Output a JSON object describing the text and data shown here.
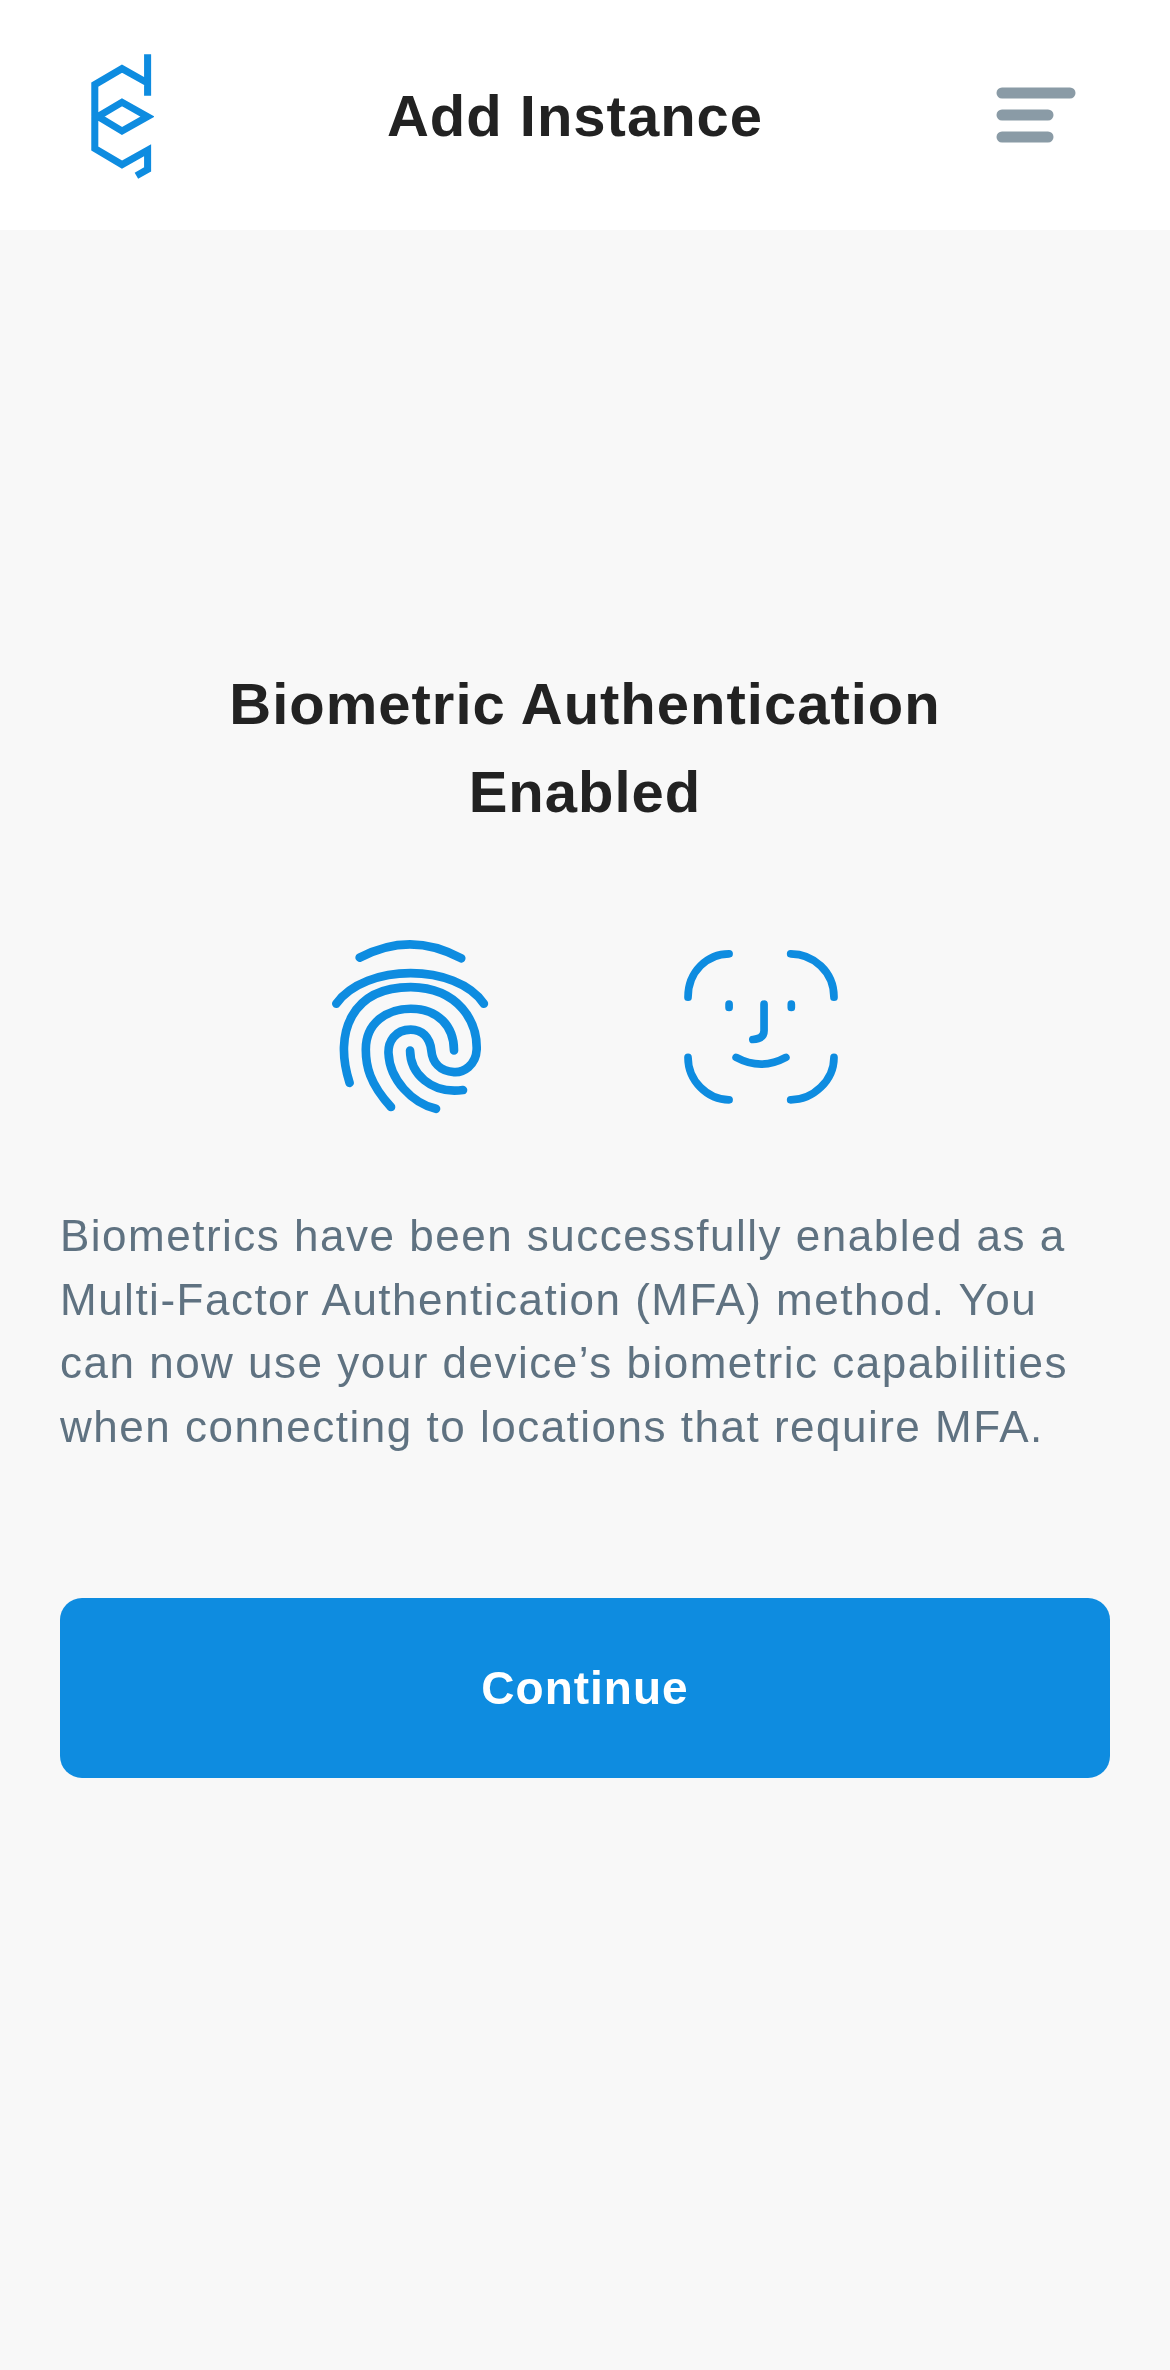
{
  "header": {
    "title": "Add Instance"
  },
  "heading": "Biometric Authentication Enabled",
  "message": "Biometrics have been successfully enabled as a Multi-Factor Authentication (MFA) method. You can now use your device’s biometric capabilities when connecting to locations that require MFA.",
  "button": {
    "label": "Continue"
  }
}
